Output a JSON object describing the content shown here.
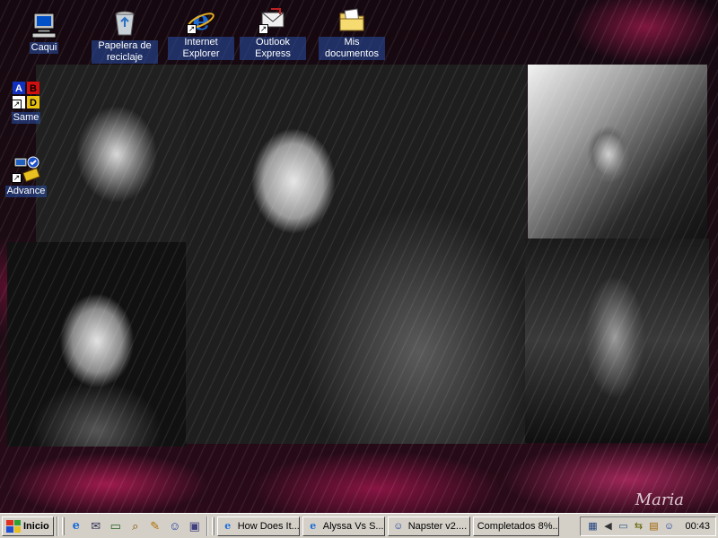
{
  "desktop": {
    "icons": [
      {
        "label": "Caqui",
        "icon": "my-computer-icon"
      },
      {
        "label": "Papelera de reciclaje",
        "icon": "recycle-bin-icon"
      },
      {
        "label": "Internet Explorer",
        "icon": "internet-explorer-icon"
      },
      {
        "label": "Outlook Express",
        "icon": "outlook-express-icon"
      },
      {
        "label": "Mis documentos",
        "icon": "my-documents-icon"
      },
      {
        "label": "Same",
        "icon": "same-game-icon"
      },
      {
        "label": "Advance",
        "icon": "network-icon"
      }
    ],
    "same_letters": [
      "A",
      "B",
      "C",
      "D"
    ]
  },
  "taskbar": {
    "start_label": "Inicio",
    "tasks": [
      {
        "label": "How Does It...",
        "icon": "internet-explorer-icon"
      },
      {
        "label": "Alyssa Vs S...",
        "icon": "internet-explorer-icon"
      },
      {
        "label": "Napster v2....",
        "icon": "napster-icon"
      },
      {
        "label": "Completados 8%...",
        "icon": "download-icon"
      }
    ],
    "clock": "00:43"
  },
  "colors": {
    "taskbar_face": "#d4d0c8",
    "icon_label_bg": "#2850aa",
    "wallpaper_accent": "#ff2878"
  }
}
